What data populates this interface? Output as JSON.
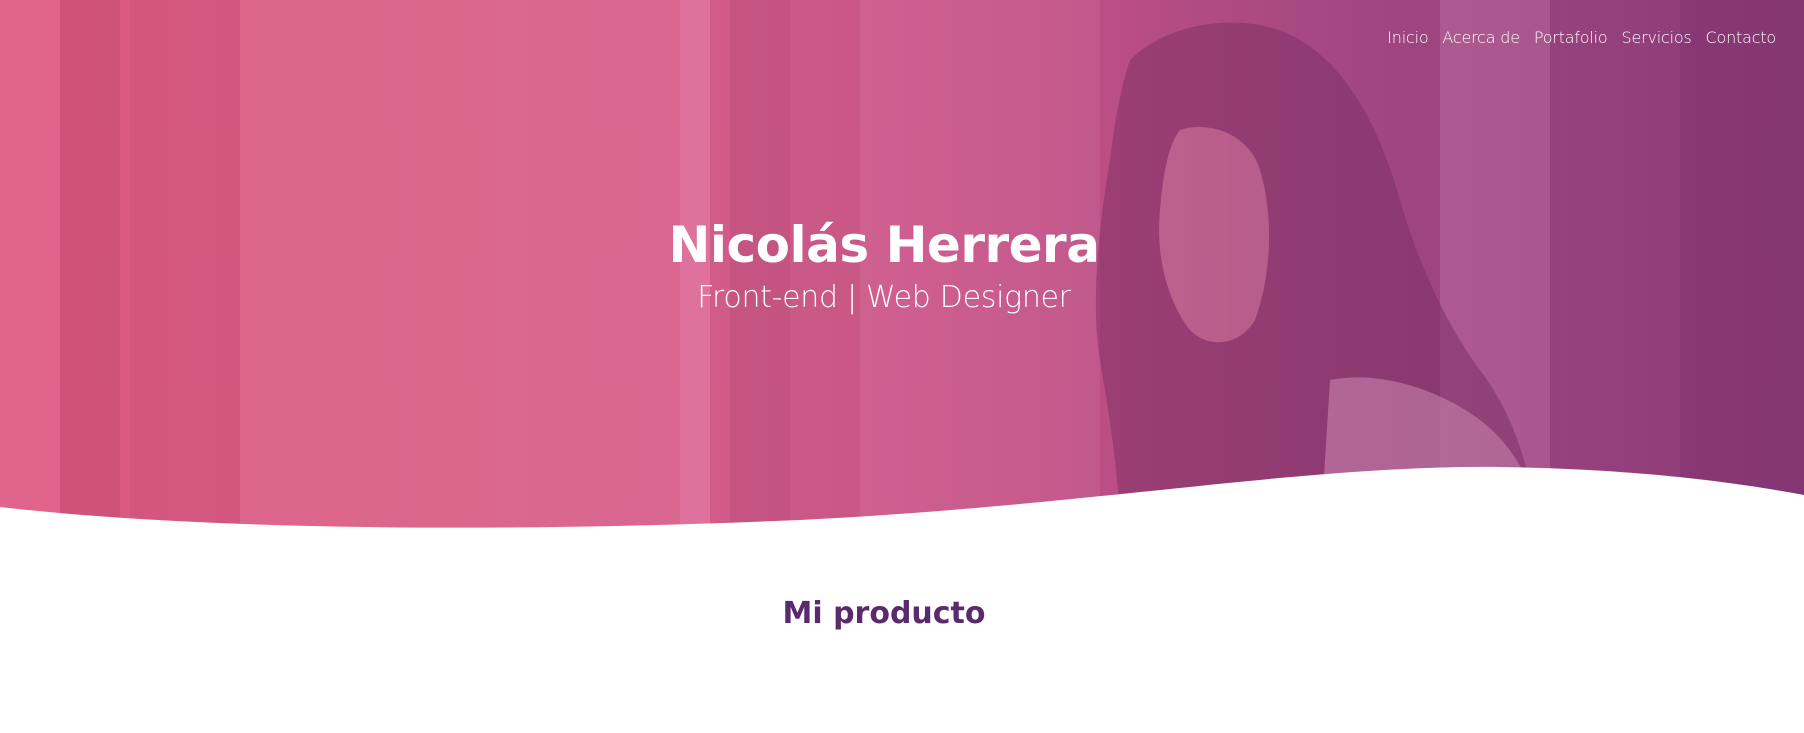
{
  "nav": {
    "items": [
      "Inicio",
      "Acerca de",
      "Portafolio",
      "Servicios",
      "Contacto"
    ]
  },
  "hero": {
    "name": "Nicolás Herrera",
    "role": "Front-end | Web Designer"
  },
  "section": {
    "title": "Mi producto"
  },
  "colors": {
    "hero_pink": "#d9658b",
    "hero_purple": "#8c3b78",
    "heading_purple": "#5a2a6e",
    "text_white": "#ffffff"
  }
}
